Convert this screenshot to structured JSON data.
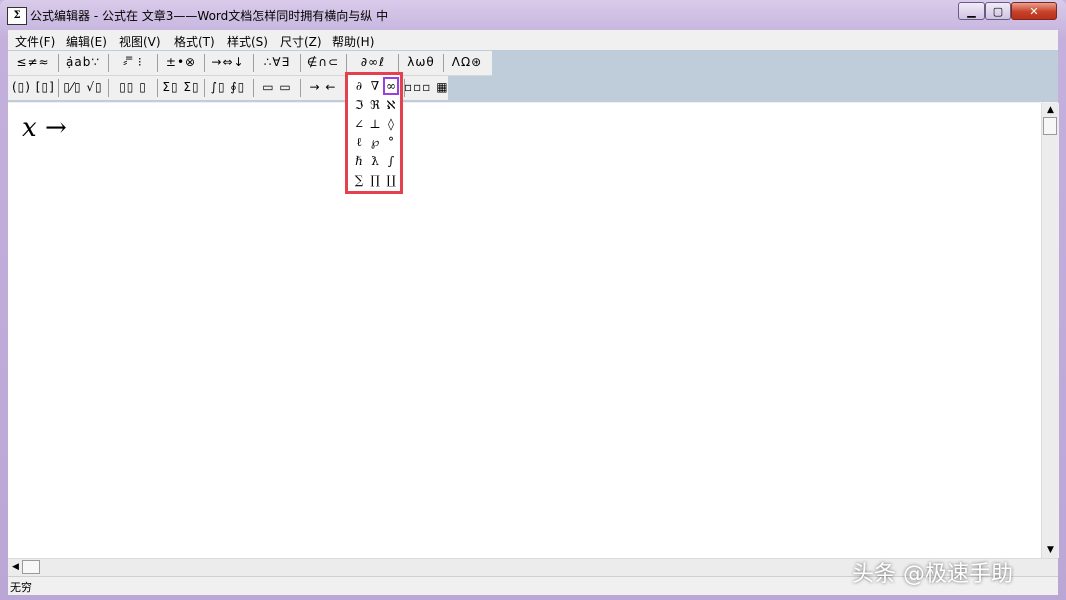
{
  "window": {
    "icon_text": "Σ",
    "title": "公式编辑器 - 公式在 文章3——Word文档怎样同时拥有横向与纵 中",
    "buttons": {
      "minimize": "▁",
      "maximize": "▢",
      "close": "✕"
    }
  },
  "menu": {
    "items": [
      "文件(F)",
      "编辑(E)",
      "视图(V)",
      "格式(T)",
      "样式(S)",
      "尺寸(Z)",
      "帮助(H)"
    ]
  },
  "toolbar": {
    "row1": [
      "≤≠≈",
      "ạ̇ab∵",
      "⸗ ̿ ⁝",
      "±•⊗",
      "→⇔↓",
      "∴∀∃",
      "∉∩⊂",
      "∂∞ℓ",
      "λωθ",
      "ΛΩ⊛"
    ],
    "row2": [
      "(▯) [▯]",
      "▯⁄▯ √▯",
      "▯▯ ▯",
      "Σ▯ Σ▯",
      "∫▯ ∮▯",
      "▭ ▭",
      "→ ←",
      "▫▫▫ ▦"
    ]
  },
  "palette": {
    "rows": [
      [
        "∂",
        "∇",
        "∞"
      ],
      [
        "ℑ",
        "ℜ",
        "ℵ"
      ],
      [
        "∠",
        "⊥",
        "◊"
      ],
      [
        "ℓ",
        "℘",
        "°"
      ],
      [
        "ℏ",
        "ƛ",
        "∫"
      ],
      [
        "∑",
        "∏",
        "∐"
      ]
    ],
    "selected": "∞"
  },
  "document": {
    "formula_var": "x",
    "formula_arrow": "→"
  },
  "scrollbar": {
    "up": "▲",
    "down": "▼",
    "left": "◀"
  },
  "status": {
    "text": "无穷"
  },
  "watermark": "头条 @极速手助",
  "colors": {
    "palette_border": "#e5404e",
    "selected_border": "#9b3fe0",
    "toolbar_bg": "#bfcddb",
    "close_button": "#c7412a"
  }
}
